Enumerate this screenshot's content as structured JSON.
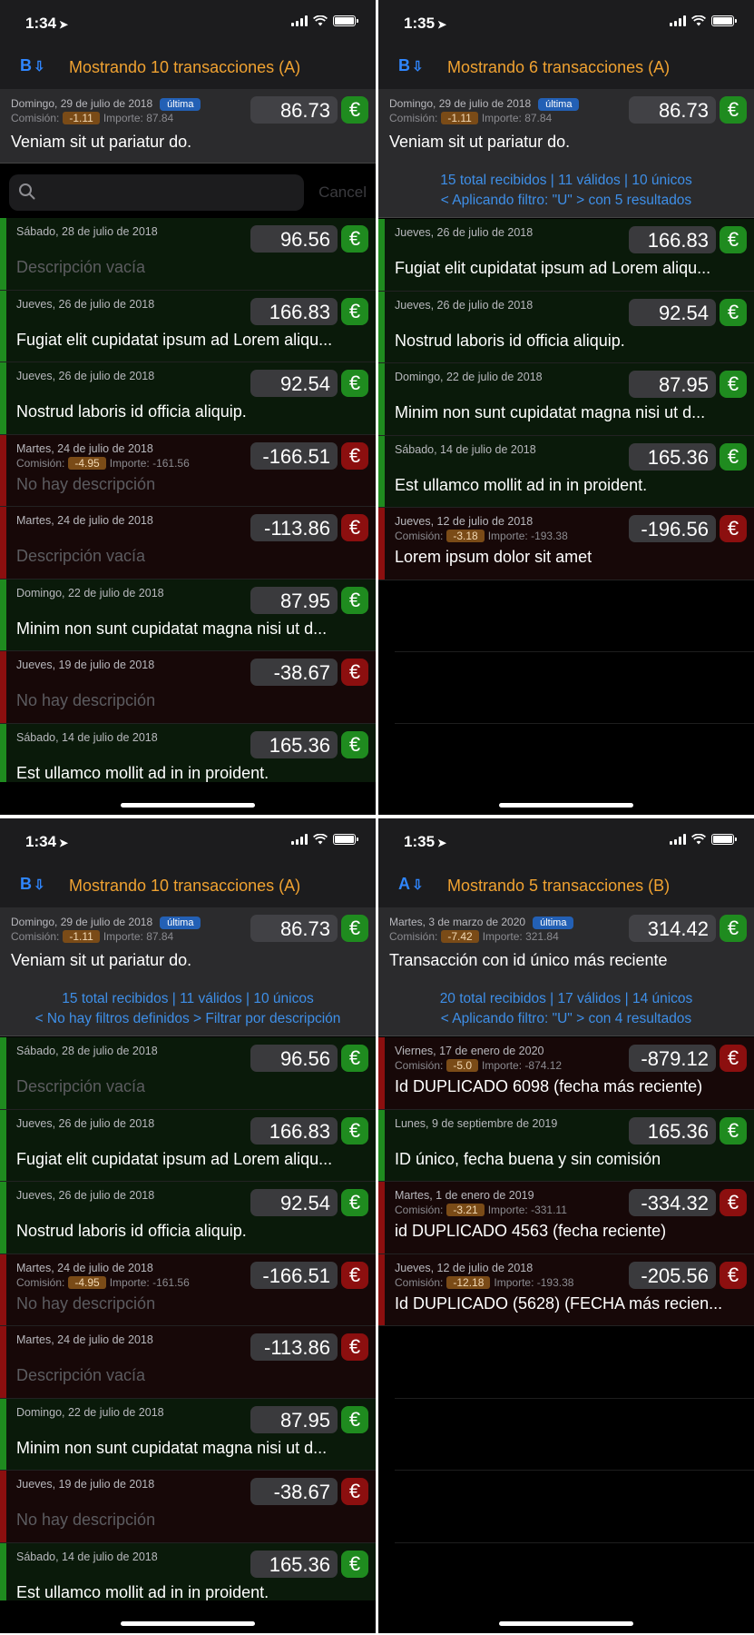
{
  "screens": [
    {
      "status": {
        "time": "1:34"
      },
      "nav": {
        "sort_label": "B",
        "title": "Mostrando 10 transacciones (A)"
      },
      "header": {
        "date": "Domingo, 29 de julio de 2018",
        "badge": "última",
        "commission_label": "Comisión:",
        "commission": "-1.11",
        "importe_label": "Importe:",
        "importe": "87.84",
        "amount": "86.73",
        "currency": "€",
        "description": "Veniam sit ut pariatur do."
      },
      "search": {
        "placeholder": "",
        "cancel": "Cancel"
      },
      "rows": [
        {
          "date": "Sábado, 28 de julio de 2018",
          "amount": "96.56",
          "currency": "€",
          "description": "Descripción vacía",
          "empty": true
        },
        {
          "date": "Jueves, 26 de julio de 2018",
          "amount": "166.83",
          "currency": "€",
          "description": "Fugiat elit cupidatat ipsum ad Lorem aliqu..."
        },
        {
          "date": "Jueves, 26 de julio de 2018",
          "amount": "92.54",
          "currency": "€",
          "description": "Nostrud laboris id officia aliquip."
        },
        {
          "date": "Martes, 24 de julio de 2018",
          "commission_label": "Comisión:",
          "commission": "-4.95",
          "importe_label": "Importe:",
          "importe": "-161.56",
          "amount": "-166.51",
          "currency": "€",
          "description": "No hay descripción",
          "empty": true,
          "negative": true
        },
        {
          "date": "Martes, 24 de julio de 2018",
          "amount": "-113.86",
          "currency": "€",
          "description": "Descripción vacía",
          "empty": true,
          "negative": true
        },
        {
          "date": "Domingo, 22 de julio de 2018",
          "amount": "87.95",
          "currency": "€",
          "description": "Minim non sunt cupidatat magna nisi ut d..."
        },
        {
          "date": "Jueves, 19 de julio de 2018",
          "amount": "-38.67",
          "currency": "€",
          "description": "No hay descripción",
          "empty": true,
          "negative": true
        },
        {
          "date": "Sábado, 14 de julio de 2018",
          "amount": "165.36",
          "currency": "€",
          "description": "Est ullamco mollit ad in in proident."
        }
      ]
    },
    {
      "status": {
        "time": "1:35"
      },
      "nav": {
        "sort_label": "B",
        "title": "Mostrando 6 transacciones (A)"
      },
      "header": {
        "date": "Domingo, 29 de julio de 2018",
        "badge": "última",
        "commission_label": "Comisión:",
        "commission": "-1.11",
        "importe_label": "Importe:",
        "importe": "87.84",
        "amount": "86.73",
        "currency": "€",
        "description": "Veniam sit ut pariatur do.",
        "stats": "15 total recibidos | 11 válidos | 10 únicos",
        "filter": "< Aplicando filtro: \"U\" > con 5 resultados"
      },
      "rows": [
        {
          "date": "Jueves, 26 de julio de 2018",
          "amount": "166.83",
          "currency": "€",
          "description": "Fugiat elit cupidatat ipsum ad Lorem aliqu..."
        },
        {
          "date": "Jueves, 26 de julio de 2018",
          "amount": "92.54",
          "currency": "€",
          "description": "Nostrud laboris id officia aliquip."
        },
        {
          "date": "Domingo, 22 de julio de 2018",
          "amount": "87.95",
          "currency": "€",
          "description": "Minim non sunt cupidatat magna nisi ut d..."
        },
        {
          "date": "Sábado, 14 de julio de 2018",
          "amount": "165.36",
          "currency": "€",
          "description": "Est ullamco mollit ad in in proident."
        },
        {
          "date": "Jueves, 12 de julio de 2018",
          "commission_label": "Comisión:",
          "commission": "-3.18",
          "importe_label": "Importe:",
          "importe": "-193.38",
          "amount": "-196.56",
          "currency": "€",
          "description": "Lorem ipsum dolor sit amet",
          "negative": true
        }
      ]
    },
    {
      "status": {
        "time": "1:34"
      },
      "nav": {
        "sort_label": "B",
        "title": "Mostrando 10 transacciones (A)"
      },
      "header": {
        "date": "Domingo, 29 de julio de 2018",
        "badge": "última",
        "commission_label": "Comisión:",
        "commission": "-1.11",
        "importe_label": "Importe:",
        "importe": "87.84",
        "amount": "86.73",
        "currency": "€",
        "description": "Veniam sit ut pariatur do.",
        "stats": "15 total recibidos | 11 válidos | 10 únicos",
        "filter": "< No hay filtros definidos > Filtrar por descripción"
      },
      "rows": [
        {
          "date": "Sábado, 28 de julio de 2018",
          "amount": "96.56",
          "currency": "€",
          "description": "Descripción vacía",
          "empty": true
        },
        {
          "date": "Jueves, 26 de julio de 2018",
          "amount": "166.83",
          "currency": "€",
          "description": "Fugiat elit cupidatat ipsum ad Lorem aliqu..."
        },
        {
          "date": "Jueves, 26 de julio de 2018",
          "amount": "92.54",
          "currency": "€",
          "description": "Nostrud laboris id officia aliquip."
        },
        {
          "date": "Martes, 24 de julio de 2018",
          "commission_label": "Comisión:",
          "commission": "-4.95",
          "importe_label": "Importe:",
          "importe": "-161.56",
          "amount": "-166.51",
          "currency": "€",
          "description": "No hay descripción",
          "empty": true,
          "negative": true
        },
        {
          "date": "Martes, 24 de julio de 2018",
          "amount": "-113.86",
          "currency": "€",
          "description": "Descripción vacía",
          "empty": true,
          "negative": true
        },
        {
          "date": "Domingo, 22 de julio de 2018",
          "amount": "87.95",
          "currency": "€",
          "description": "Minim non sunt cupidatat magna nisi ut d..."
        },
        {
          "date": "Jueves, 19 de julio de 2018",
          "amount": "-38.67",
          "currency": "€",
          "description": "No hay descripción",
          "empty": true,
          "negative": true
        },
        {
          "date": "Sábado, 14 de julio de 2018",
          "amount": "165.36",
          "currency": "€",
          "description": "Est ullamco mollit ad in in proident."
        }
      ]
    },
    {
      "status": {
        "time": "1:35"
      },
      "nav": {
        "sort_label": "A",
        "title": "Mostrando 5 transacciones (B)"
      },
      "header": {
        "date": "Martes, 3 de marzo de 2020",
        "badge": "última",
        "commission_label": "Comisión:",
        "commission": "-7.42",
        "importe_label": "Importe:",
        "importe": "321.84",
        "amount": "314.42",
        "currency": "€",
        "description": "Transacción con id único más reciente",
        "stats": "20 total recibidos | 17 válidos | 14 únicos",
        "filter": "< Aplicando filtro: \"U\" > con 4 resultados"
      },
      "rows": [
        {
          "date": "Viernes, 17 de enero de 2020",
          "commission_label": "Comisión:",
          "commission": "-5.0",
          "importe_label": "Importe:",
          "importe": "-874.12",
          "amount": "-879.12",
          "currency": "€",
          "description": "Id DUPLICADO 6098 (fecha más reciente)",
          "negative": true
        },
        {
          "date": "Lunes, 9 de septiembre de 2019",
          "amount": "165.36",
          "currency": "€",
          "description": "ID único, fecha buena y sin comisión"
        },
        {
          "date": "Martes, 1 de enero de 2019",
          "commission_label": "Comisión:",
          "commission": "-3.21",
          "importe_label": "Importe:",
          "importe": "-331.11",
          "amount": "-334.32",
          "currency": "€",
          "description": "id DUPLICADO 4563 (fecha reciente)",
          "negative": true
        },
        {
          "date": "Jueves, 12 de julio de 2018",
          "commission_label": "Comisión:",
          "commission": "-12.18",
          "importe_label": "Importe:",
          "importe": "-193.38",
          "amount": "-205.56",
          "currency": "€",
          "description": "Id DUPLICADO (5628) (FECHA más recien...",
          "negative": true
        }
      ]
    }
  ]
}
